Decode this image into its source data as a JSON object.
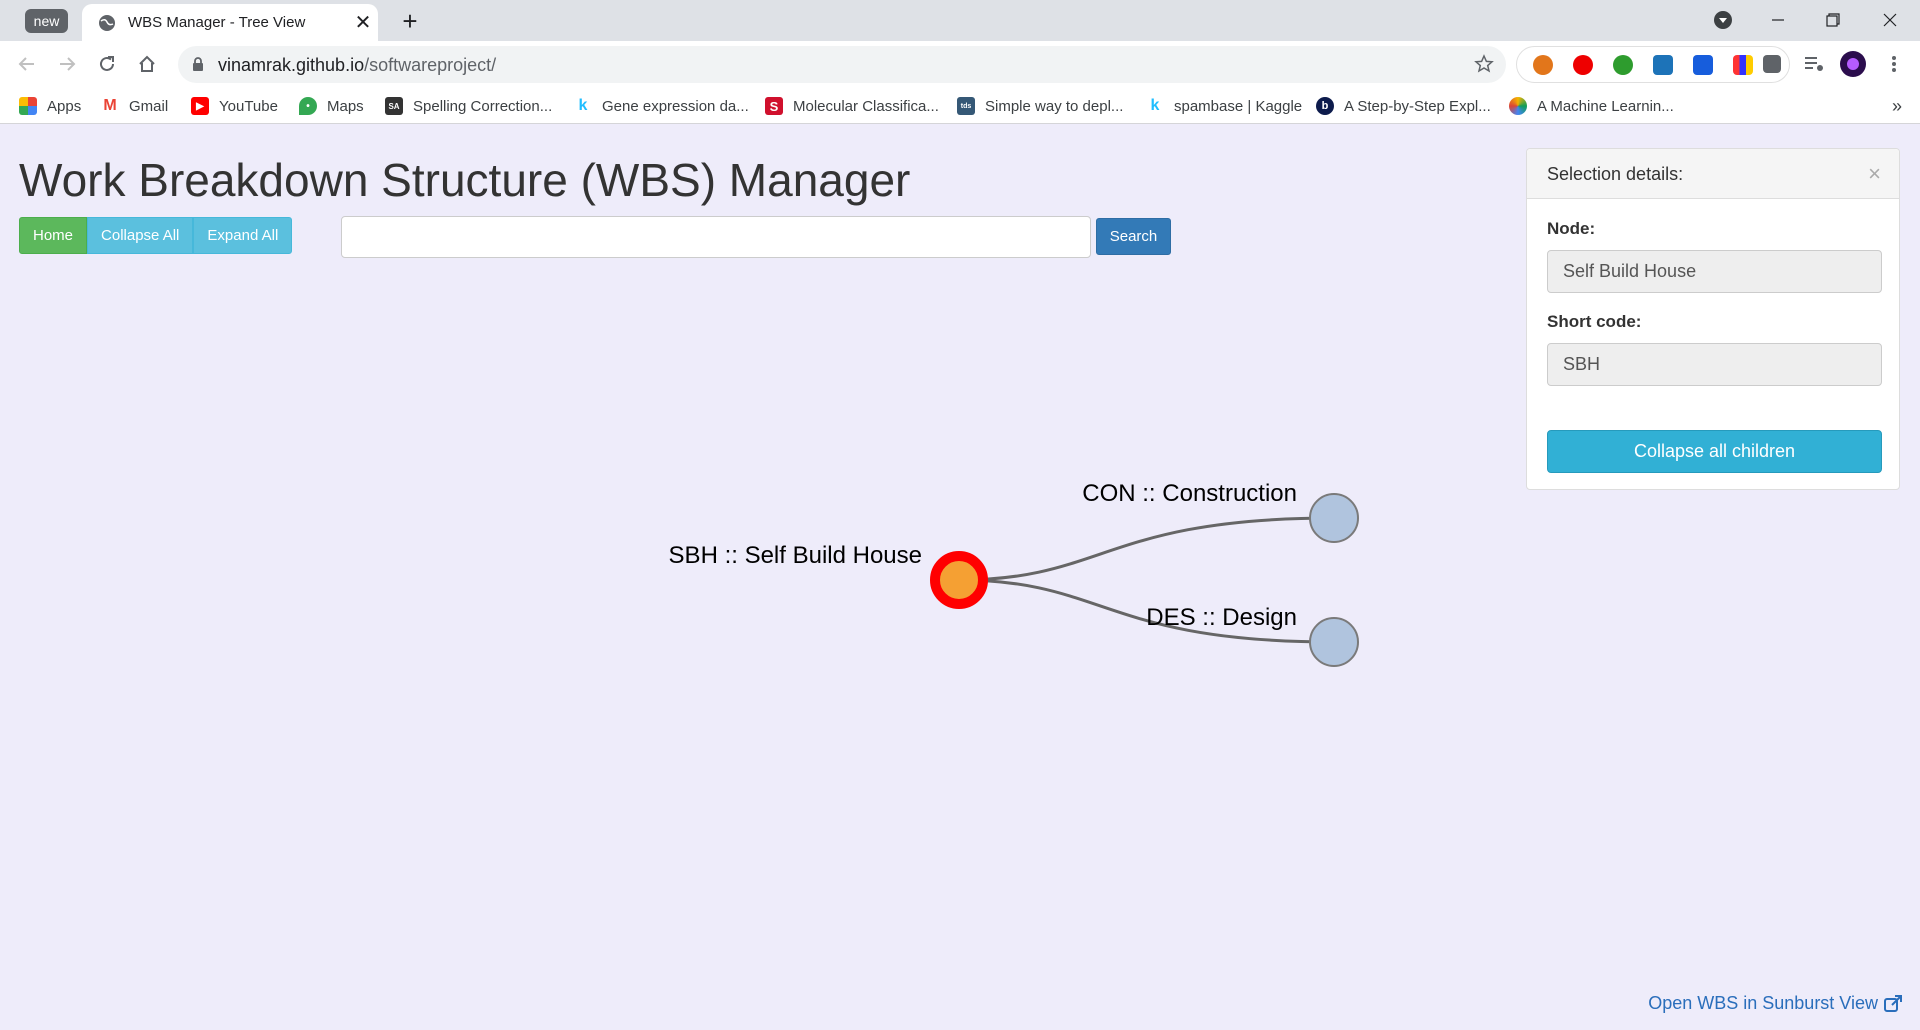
{
  "browser": {
    "new_badge": "new",
    "tab_title": "WBS Manager - Tree View",
    "url_host": "vinamrak.github.io",
    "url_path": "/softwareproject/",
    "bookmarks": [
      {
        "label": "Apps",
        "icon": "apps-grid-icon"
      },
      {
        "label": "Gmail",
        "icon": "gmail-icon"
      },
      {
        "label": "YouTube",
        "icon": "youtube-icon"
      },
      {
        "label": "Maps",
        "icon": "maps-icon"
      },
      {
        "label": "Spelling Correction...",
        "icon": "sa-icon"
      },
      {
        "label": "Gene expression da...",
        "icon": "kaggle-icon"
      },
      {
        "label": "Molecular Classifica...",
        "icon": "s-icon"
      },
      {
        "label": "Simple way to depl...",
        "icon": "tds-icon"
      },
      {
        "label": "spambase | Kaggle",
        "icon": "kaggle-icon"
      },
      {
        "label": "A Step-by-Step Expl...",
        "icon": "b-icon"
      },
      {
        "label": "A Machine Learnin...",
        "icon": "ml-icon"
      }
    ],
    "bookmarks_more": "»"
  },
  "page": {
    "title": "Work Breakdown Structure (WBS) Manager",
    "buttons": {
      "home": "Home",
      "collapse_all": "Collapse All",
      "expand_all": "Expand All"
    },
    "search": {
      "value": "",
      "placeholder": "",
      "button": "Search"
    },
    "sunburst_link": "Open WBS in Sunburst View"
  },
  "tree": {
    "root": {
      "label": "SBH :: Self Build House",
      "fill": "#f5a033",
      "stroke": "#ff0000"
    },
    "children": [
      {
        "label": "CON :: Construction",
        "fill": "#b0c4de",
        "stroke": "#7a7a7a"
      },
      {
        "label": "DES :: Design",
        "fill": "#b0c4de",
        "stroke": "#7a7a7a"
      }
    ],
    "link_color": "#666666"
  },
  "panel": {
    "title": "Selection details:",
    "close": "×",
    "node_label": "Node:",
    "node_value": "Self Build House",
    "code_label": "Short code:",
    "code_value": "SBH",
    "collapse_button": "Collapse all children"
  }
}
